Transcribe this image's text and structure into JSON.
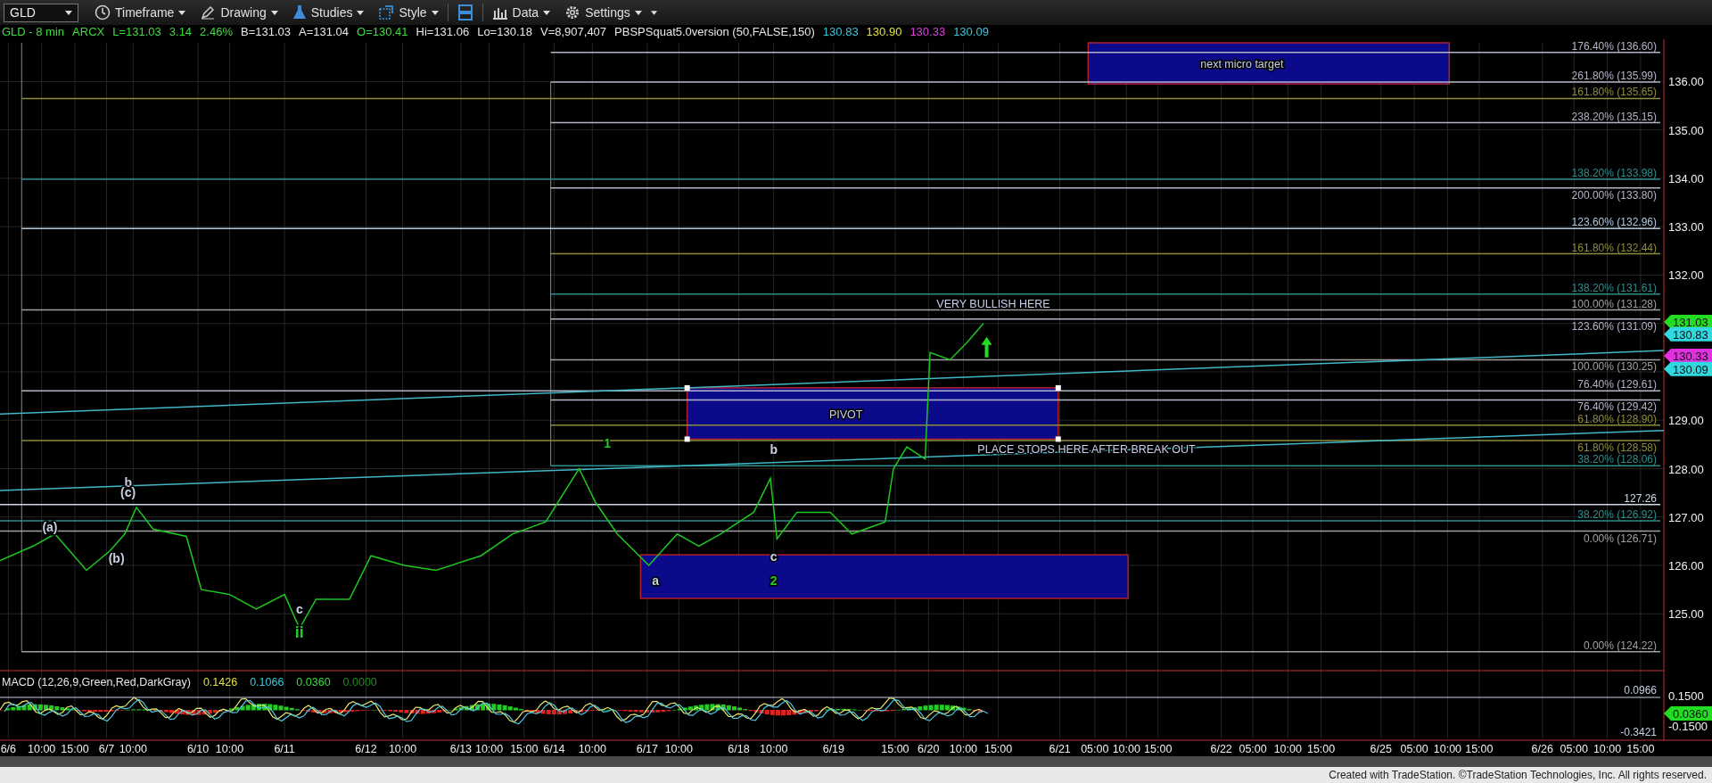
{
  "toolbar": {
    "symbol": "GLD",
    "buttons": [
      {
        "label": "Timeframe",
        "kind": "clock"
      },
      {
        "label": "Drawing",
        "kind": "pen"
      },
      {
        "label": "Studies",
        "kind": "flask"
      },
      {
        "label": "Style",
        "kind": "style"
      },
      {
        "kind": "layout"
      },
      {
        "label": "Data",
        "kind": "bars"
      },
      {
        "label": "Settings",
        "kind": "gear"
      }
    ]
  },
  "info": {
    "items": [
      {
        "text": "GLD - 8 min",
        "color": "#3cdc3c"
      },
      {
        "text": "ARCX",
        "color": "#3cdc3c"
      },
      {
        "text": "L=131.03",
        "color": "#3cdc3c"
      },
      {
        "text": "3.14",
        "color": "#3cdc3c"
      },
      {
        "text": "2.46%",
        "color": "#3cdc3c"
      },
      {
        "text": "B=131.03",
        "color": "#e8e8e8"
      },
      {
        "text": "A=131.04",
        "color": "#e8e8e8"
      },
      {
        "text": "O=130.41",
        "color": "#3cdc3c"
      },
      {
        "text": "Hi=131.06",
        "color": "#e8e8e8"
      },
      {
        "text": "Lo=130.18",
        "color": "#e8e8e8"
      },
      {
        "text": "V=8,907,407",
        "color": "#e8e8e8"
      },
      {
        "text": "PBSPSquat5.0version (50,FALSE,150)",
        "color": "#e8e8e8"
      },
      {
        "text": "130.83",
        "color": "#3cc8dc"
      },
      {
        "text": "130.90",
        "color": "#e0e040"
      },
      {
        "text": "130.33",
        "color": "#e040e0"
      },
      {
        "text": "130.09",
        "color": "#3cc8dc"
      }
    ]
  },
  "chart": {
    "price_axis": [
      "136.00",
      "135.00",
      "134.00",
      "133.00",
      "132.00",
      "129.00",
      "128.00",
      "127.00",
      "126.00",
      "125.00"
    ],
    "time_axis": [
      "6/6",
      "10:00",
      "15:00",
      "6/7",
      "10:00",
      "6/10",
      "10:00",
      "6/11",
      "6/12",
      "10:00",
      "6/13",
      "10:00",
      "15:00",
      "6/14",
      "10:00",
      "6/17",
      "10:00",
      "6/18",
      "10:00",
      "6/19",
      "15:00",
      "6/20",
      "10:00",
      "15:00",
      "6/21",
      "05:00",
      "10:00",
      "15:00",
      "6/22",
      "05:00",
      "10:00",
      "15:00",
      "6/25",
      "05:00",
      "10:00",
      "15:00",
      "6/26",
      "05:00",
      "10:00",
      "15:00"
    ],
    "fib_levels": [
      {
        "text": "176.40% (136.60)",
        "color": "#b4b4c8"
      },
      {
        "text": "261.80% (135.99)",
        "color": "#b4b4c8"
      },
      {
        "text": "161.80% (135.65)",
        "color": "#8c8c3c"
      },
      {
        "text": "238.20% (135.15)",
        "color": "#b4b4c8"
      },
      {
        "text": "138.20% (133.98)",
        "color": "#2e8c8c"
      },
      {
        "text": "200.00% (133.80)",
        "color": "#b4b4c8"
      },
      {
        "text": "123.60% (132.96)",
        "color": "#b0c8e0"
      },
      {
        "text": "161.80% (132.44)",
        "color": "#8c8c3c"
      },
      {
        "text": "138.20% (131.61)",
        "color": "#2e8c8c"
      },
      {
        "text": "100.00% (131.28)",
        "color": "#a0a0a0"
      },
      {
        "text": "123.60% (131.09)",
        "color": "#b4b4c8"
      },
      {
        "text": "100.00% (130.25)",
        "color": "#a0a0a0"
      },
      {
        "text": "76.40% (129.61)",
        "color": "#b4b4c8"
      },
      {
        "text": "76.40% (129.42)",
        "color": "#b4b4c8"
      },
      {
        "text": "61.80% (128.90)",
        "color": "#8c8c3c"
      },
      {
        "text": "61.80% (128.58)",
        "color": "#8c8c3c"
      },
      {
        "text": "38.20% (128.06)",
        "color": "#2e8c8c"
      },
      {
        "text": "127.26",
        "color": "#d0d8e8"
      },
      {
        "text": "38.20% (126.92)",
        "color": "#2e8c8c"
      },
      {
        "text": "0.00% (126.71)",
        "color": "#a0a0a0"
      },
      {
        "text": "0.00% (124.22)",
        "color": "#a0a0a0"
      }
    ],
    "zones": [
      {
        "text": "next micro target",
        "handles": false
      },
      {
        "text": "PIVOT",
        "handles": true
      },
      {
        "handles": false
      }
    ],
    "notes": [
      "VERY BULLISH HERE",
      "PLACE STOPS HERE AFTER BREAK OUT"
    ],
    "wave_labels": [
      {
        "text": "1",
        "color": "#22cc22",
        "emphasis": false
      },
      {
        "text": "b",
        "color": "#c8d0e0",
        "emphasis": false
      },
      {
        "text": "c",
        "color": "#c8d0e0",
        "emphasis": false
      },
      {
        "text": "2",
        "color": "#22cc22",
        "emphasis": false
      },
      {
        "text": "a",
        "color": "#c8d0e0",
        "emphasis": false
      },
      {
        "text": "c",
        "color": "#c8d0e0",
        "emphasis": false
      },
      {
        "text": "ii",
        "color": "#22cc22",
        "emphasis": true
      },
      {
        "text": "b",
        "color": "#c8d0e0",
        "emphasis": false
      },
      {
        "text": "(c)",
        "color": "#c8d0e0",
        "emphasis": false
      },
      {
        "text": "(a)",
        "color": "#c8d0e0",
        "emphasis": false
      },
      {
        "text": "(b)",
        "color": "#c8d0e0",
        "emphasis": false
      }
    ],
    "price_flags": [
      {
        "text": "131.03",
        "color": "#22dd22"
      },
      {
        "text": "130.83",
        "color": "#30d8e0"
      },
      {
        "text": "130.33",
        "color": "#e030e0"
      },
      {
        "text": "130.09",
        "color": "#30d8e0"
      }
    ]
  },
  "macd": {
    "legend": [
      {
        "text": "MACD (12,26,9,Green,Red,DarkGray)",
        "color": "#e8e8e8"
      },
      {
        "text": "0.1426",
        "color": "#e0e040"
      },
      {
        "text": "0.1066",
        "color": "#3cc8dc"
      },
      {
        "text": "0.0360",
        "color": "#3cdc3c"
      },
      {
        "text": "0.0000",
        "color": "#1e8c1e"
      }
    ],
    "axis_labels": [
      "0.1500",
      "-0.1500"
    ],
    "level_labels": [
      "0.0966",
      "-0.3421"
    ],
    "flag": {
      "text": "0.0360",
      "color": "#22dd22"
    }
  },
  "footer": "Created with TradeStation. ©TradeStation Technologies, Inc. All rights reserved."
}
